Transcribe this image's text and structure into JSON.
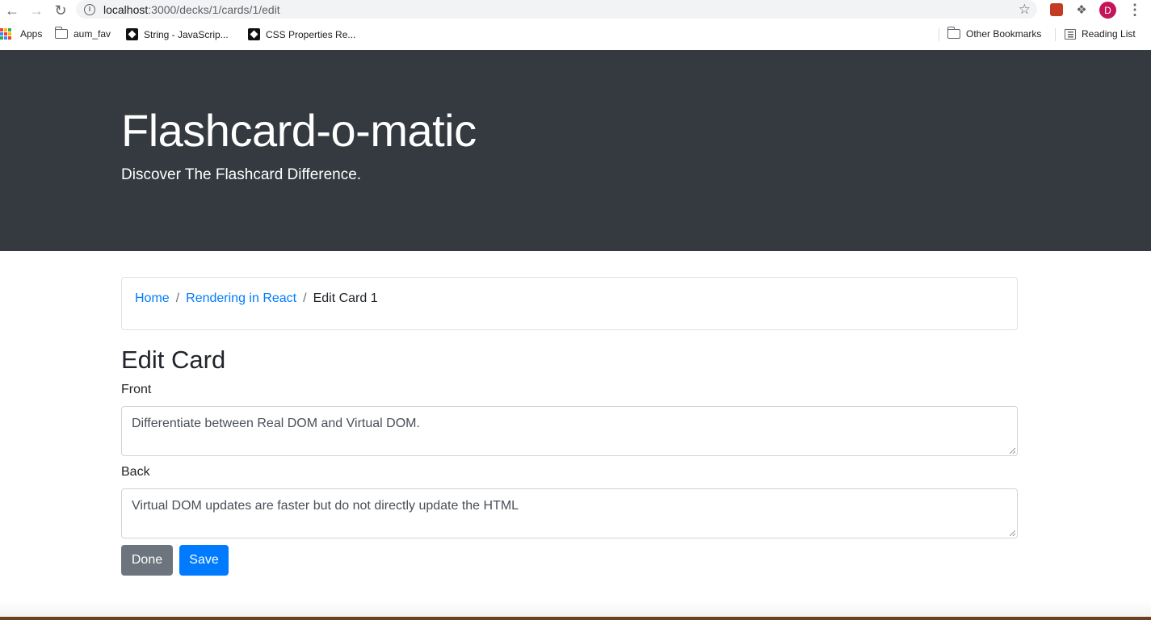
{
  "browser": {
    "url_host": "localhost",
    "url_path": ":3000/decks/1/cards/1/edit",
    "avatar_letter": "D",
    "bookmarks": [
      {
        "label": "Apps",
        "icon": "apps-grid-icon"
      },
      {
        "label": "aum_fav",
        "icon": "folder-icon"
      },
      {
        "label": "String - JavaScrip...",
        "icon": "site-favicon"
      },
      {
        "label": "CSS Properties Re...",
        "icon": "site-favicon"
      }
    ],
    "other_bookmarks": "Other Bookmarks",
    "reading_list": "Reading List"
  },
  "header": {
    "title": "Flashcard-o-matic",
    "subtitle": "Discover The Flashcard Difference."
  },
  "breadcrumb": {
    "home": "Home",
    "deck": "Rendering in React",
    "current": "Edit Card 1"
  },
  "form": {
    "heading": "Edit Card",
    "front_label": "Front",
    "front_value": "Differentiate between Real DOM and Virtual DOM.",
    "back_label": "Back",
    "back_value": "Virtual DOM updates are faster but do not directly update the HTML",
    "done_label": "Done",
    "save_label": "Save"
  },
  "colors": {
    "jumbotron_bg": "#343a40",
    "link": "#007bff",
    "secondary": "#6c757d",
    "primary": "#007bff"
  }
}
